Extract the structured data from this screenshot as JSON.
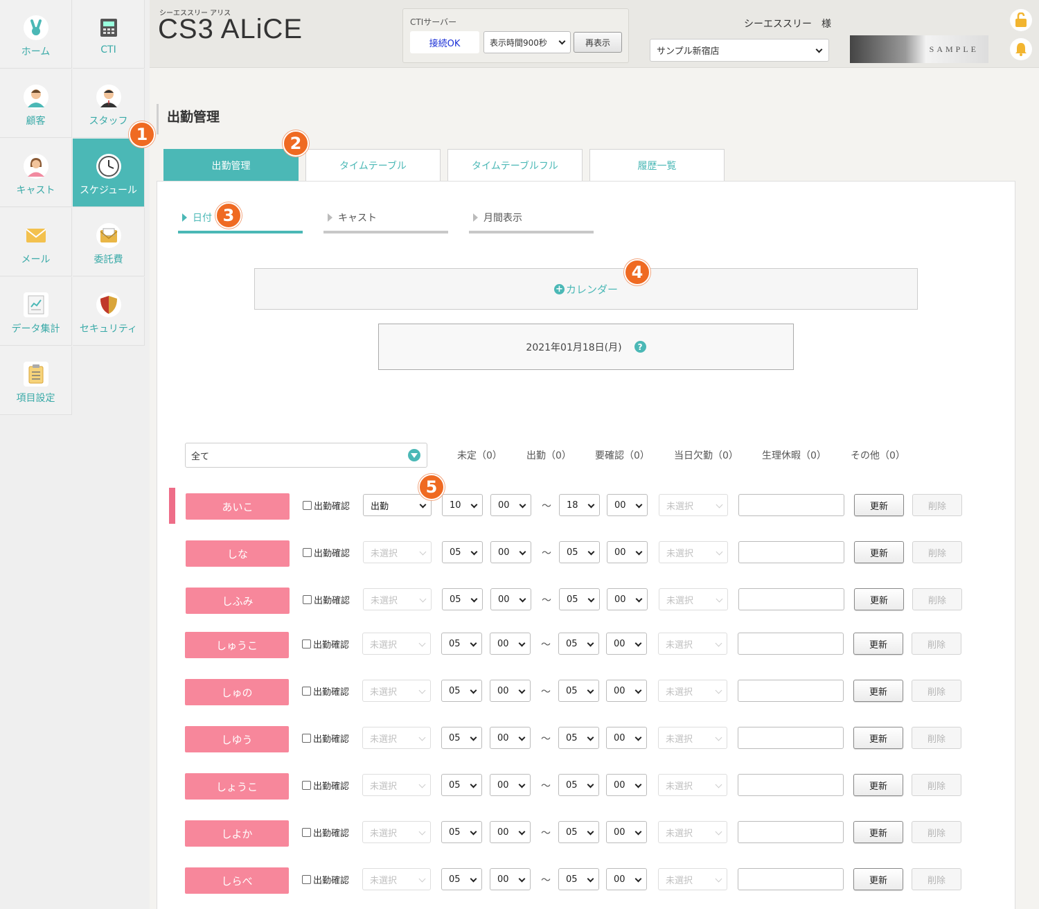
{
  "sidebar": {
    "items": [
      {
        "label": "ホーム"
      },
      {
        "label": "CTI"
      },
      {
        "label": "顧客"
      },
      {
        "label": "スタッフ"
      },
      {
        "label": "キャスト"
      },
      {
        "label": "スケジュール"
      },
      {
        "label": "メール"
      },
      {
        "label": "委託費"
      },
      {
        "label": "データ集計"
      },
      {
        "label": "セキュリティ"
      },
      {
        "label": "項目設定"
      }
    ]
  },
  "header": {
    "brand_sub": "シーエススリー アリス",
    "brand": "CS3 ALiCE",
    "cti_title": "CTIサーバー",
    "cti_status": "接続OK",
    "cti_interval": "表示時間900秒",
    "cti_refresh": "再表示",
    "user_name": "シーエススリー　様",
    "store": "サンプル新宿店",
    "banner_text": "SAMPLE",
    "colors": {
      "accent": "#4bb8b6",
      "cast": "#f7879b",
      "badge": "#ef6a22"
    }
  },
  "page": {
    "title": "出勤管理",
    "tabs": [
      "出勤管理",
      "タイムテーブル",
      "タイムテーブルフル",
      "履歴一覧"
    ],
    "subtabs": [
      "日付",
      "キャスト",
      "月間表示"
    ],
    "calendar_label": "カレンダー",
    "date": "2021年01月18日(月)",
    "help": "?",
    "filter": "全て",
    "counts": [
      "未定（0）",
      "出勤（0）",
      "要確認（0）",
      "当日欠勤（0）",
      "生理休暇（0）",
      "その他（0）"
    ]
  },
  "rows": {
    "check_label": "出勤確認",
    "tilde": "〜",
    "update": "更新",
    "delete": "削除",
    "items": [
      {
        "name": "あいこ",
        "status": "出勤",
        "sh": "10",
        "sm": "00",
        "eh": "18",
        "em": "00",
        "type": "未選択"
      },
      {
        "name": "しな",
        "status": "未選択",
        "sh": "05",
        "sm": "00",
        "eh": "05",
        "em": "00",
        "type": "未選択"
      },
      {
        "name": "しふみ",
        "status": "未選択",
        "sh": "05",
        "sm": "00",
        "eh": "05",
        "em": "00",
        "type": "未選択"
      },
      {
        "name": "しゅうこ",
        "status": "未選択",
        "sh": "05",
        "sm": "00",
        "eh": "05",
        "em": "00",
        "type": "未選択"
      },
      {
        "name": "しゅの",
        "status": "未選択",
        "sh": "05",
        "sm": "00",
        "eh": "05",
        "em": "00",
        "type": "未選択"
      },
      {
        "name": "しゆう",
        "status": "未選択",
        "sh": "05",
        "sm": "00",
        "eh": "05",
        "em": "00",
        "type": "未選択"
      },
      {
        "name": "しょうこ",
        "status": "未選択",
        "sh": "05",
        "sm": "00",
        "eh": "05",
        "em": "00",
        "type": "未選択"
      },
      {
        "name": "しよか",
        "status": "未選択",
        "sh": "05",
        "sm": "00",
        "eh": "05",
        "em": "00",
        "type": "未選択"
      },
      {
        "name": "しらべ",
        "status": "未選択",
        "sh": "05",
        "sm": "00",
        "eh": "05",
        "em": "00",
        "type": "未選択"
      }
    ]
  },
  "badges": [
    "1",
    "2",
    "3",
    "4",
    "5"
  ]
}
